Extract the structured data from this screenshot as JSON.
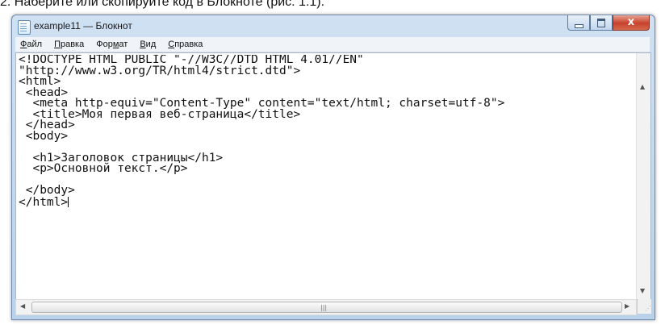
{
  "caption": "2. Наберите или скопируйте код в Блокноте (рис. 1.1).",
  "window": {
    "title": "example11 — Блокнот",
    "app_icon": "notepad-icon",
    "buttons": {
      "minimize_icon": "minimize-icon",
      "maximize_icon": "maximize-icon",
      "close_glyph": "x"
    }
  },
  "menu": [
    {
      "u": "Ф",
      "rest": "айл"
    },
    {
      "u": "П",
      "rest": "равка"
    },
    {
      "pre": "Фор",
      "u": "м",
      "rest": "ат"
    },
    {
      "u": "В",
      "rest": "ид"
    },
    {
      "u": "С",
      "rest": "правка"
    }
  ],
  "editor": {
    "lines": [
      "<!DOCTYPE HTML PUBLIC \"-//W3C//DTD HTML 4.01//EN\"",
      "\"http://www.w3.org/TR/html4/strict.dtd\">",
      "<html>",
      " <head>",
      "  <meta http-equiv=\"Content-Type\" content=\"text/html; charset=utf-8\">",
      "  <title>Моя первая веб-страница</title>",
      " </head>",
      " <body>",
      "",
      "  <h1>Заголовок страницы</h1>",
      "  <p>Основной текст.</p>",
      "",
      " </body>",
      "</html>"
    ]
  },
  "scrollbars": {
    "up_arrow": "▲",
    "down_arrow": "▼",
    "left_arrow": "◀",
    "right_arrow": "▶",
    "h_grip": "|||"
  }
}
